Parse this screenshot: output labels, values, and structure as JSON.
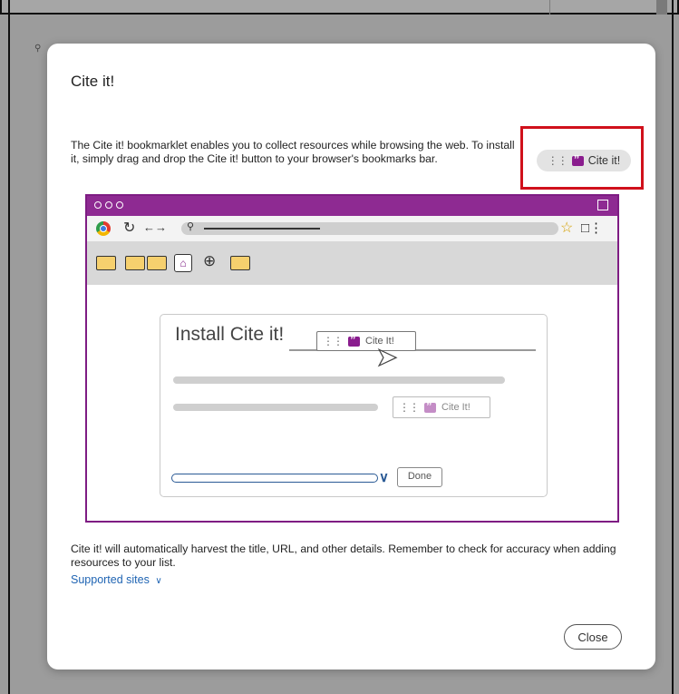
{
  "background": {
    "search_icon": "search-icon"
  },
  "modal": {
    "title": "Cite it!",
    "intro": "The Cite it! bookmarklet enables you to collect resources while browsing the web. To install it, simply drag and drop the Cite it! button to your browser's bookmarks bar.",
    "cite_button_label": "Cite it!",
    "illustration": {
      "card_title": "Install Cite it!",
      "drag_pill_label": "Cite It!",
      "pill_label": "Cite It!",
      "done_label": "Done"
    },
    "footer_text": "Cite it! will automatically harvest the title, URL, and other details. Remember to check for accuracy when adding resources to your list.",
    "supported_sites_label": "Supported sites",
    "close_label": "Close"
  },
  "colors": {
    "accent_purple": "#8e2a92",
    "link_blue": "#1f64b3",
    "highlight_red": "#d0101b"
  }
}
